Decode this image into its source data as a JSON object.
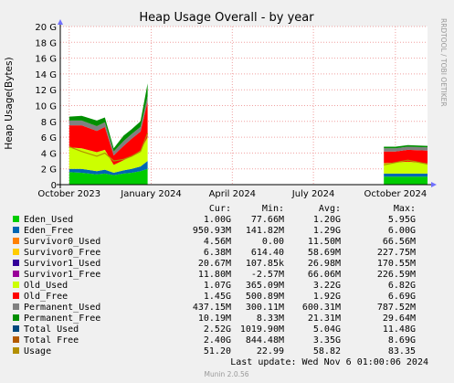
{
  "chart_data": {
    "type": "area",
    "title": "Heap Usage Overall - by year",
    "ylabel": "Heap Usage(Bytes)",
    "side_label": "RRDTOOL / TOBI OETIKER",
    "ylim": [
      0,
      20
    ],
    "yunit": "G",
    "y_ticks": [
      "0",
      "2 G",
      "4 G",
      "6 G",
      "8 G",
      "10 G",
      "12 G",
      "14 G",
      "16 G",
      "18 G",
      "20 G"
    ],
    "x_ticks": [
      "October 2023",
      "January 2024",
      "April 2024",
      "July 2024",
      "October 2024"
    ],
    "grid": true,
    "x_segments": [
      {
        "x": [
          "2023-10-01",
          "2023-10-15",
          "2023-11-01",
          "2023-11-10",
          "2023-11-20",
          "2023-12-01",
          "2023-12-10",
          "2023-12-20",
          "2023-12-28"
        ],
        "Eden_Used": [
          1.6,
          1.5,
          1.3,
          1.4,
          1.2,
          1.4,
          1.5,
          1.7,
          2.0
        ],
        "Eden_Free": [
          0.4,
          0.5,
          0.4,
          0.5,
          0.3,
          0.4,
          0.5,
          0.6,
          1.0
        ],
        "Old_Used": [
          2.7,
          2.6,
          2.4,
          2.5,
          1.0,
          1.3,
          1.6,
          2.0,
          3.0
        ],
        "Old_Free": [
          2.8,
          2.9,
          2.7,
          2.9,
          1.2,
          1.8,
          2.2,
          2.4,
          4.5
        ],
        "Permanent_Used": [
          0.6,
          0.6,
          0.6,
          0.6,
          0.5,
          0.6,
          0.6,
          0.6,
          0.7
        ],
        "Permanent_Free": [
          0.5,
          0.6,
          0.7,
          0.6,
          0.4,
          0.7,
          0.6,
          0.7,
          1.6
        ],
        "Usage": [
          4.8,
          4.2,
          3.6,
          4.0,
          3.0,
          3.2,
          3.6,
          4.2,
          6.5
        ]
      },
      {
        "x": [
          "2024-09-18",
          "2024-10-01",
          "2024-10-15",
          "2024-11-06"
        ],
        "Eden_Used": [
          1.0,
          1.0,
          1.0,
          1.0
        ],
        "Eden_Free": [
          0.4,
          0.4,
          0.4,
          0.4
        ],
        "Old_Used": [
          1.3,
          1.4,
          1.5,
          1.3
        ],
        "Old_Free": [
          1.5,
          1.4,
          1.5,
          1.6
        ],
        "Permanent_Used": [
          0.4,
          0.4,
          0.4,
          0.4
        ],
        "Permanent_Free": [
          0.2,
          0.2,
          0.2,
          0.2
        ],
        "Usage": [
          2.5,
          2.8,
          3.1,
          2.6
        ]
      }
    ],
    "table_headers": [
      "Cur:",
      "Min:",
      "Avg:",
      "Max:"
    ],
    "series": [
      {
        "name": "Eden_Used",
        "color": "#00cc00",
        "cur": "1.00G",
        "min": "77.66M",
        "avg": "1.20G",
        "max": "5.95G"
      },
      {
        "name": "Eden_Free",
        "color": "#0066b3",
        "cur": "950.93M",
        "min": "141.82M",
        "avg": "1.29G",
        "max": "6.00G"
      },
      {
        "name": "Survivor0_Used",
        "color": "#ff8000",
        "cur": "4.56M",
        "min": "0.00",
        "avg": "11.50M",
        "max": "66.56M"
      },
      {
        "name": "Survivor0_Free",
        "color": "#ffcc00",
        "cur": "6.38M",
        "min": "614.40",
        "avg": "58.69M",
        "max": "227.75M"
      },
      {
        "name": "Survivor1_Used",
        "color": "#330099",
        "cur": "20.67M",
        "min": "107.85k",
        "avg": "26.98M",
        "max": "170.55M"
      },
      {
        "name": "Survivor1_Free",
        "color": "#990099",
        "cur": "11.80M",
        "min": "-2.57M",
        "avg": "66.06M",
        "max": "226.59M"
      },
      {
        "name": "Old_Used",
        "color": "#ccff00",
        "cur": "1.07G",
        "min": "365.09M",
        "avg": "3.22G",
        "max": "6.82G"
      },
      {
        "name": "Old_Free",
        "color": "#ff0000",
        "cur": "1.45G",
        "min": "500.89M",
        "avg": "1.92G",
        "max": "6.69G"
      },
      {
        "name": "Permanent_Used",
        "color": "#808080",
        "cur": "437.15M",
        "min": "300.11M",
        "avg": "600.31M",
        "max": "787.52M"
      },
      {
        "name": "Permanent_Free",
        "color": "#008f00",
        "cur": "10.19M",
        "min": "8.33M",
        "avg": "21.31M",
        "max": "29.64M"
      },
      {
        "name": "Total Used",
        "color": "#00487d",
        "cur": "2.52G",
        "min": "1019.90M",
        "avg": "5.04G",
        "max": "11.48G"
      },
      {
        "name": "Total Free",
        "color": "#b35a00",
        "cur": "2.40G",
        "min": "844.48M",
        "avg": "3.35G",
        "max": "8.69G"
      },
      {
        "name": "Usage",
        "color": "#b38f00",
        "cur": "51.20",
        "min": "22.99",
        "avg": "58.82",
        "max": "83.35"
      }
    ],
    "last_update": "Last update: Wed Nov  6 01:00:06 2024",
    "footer": "Munin 2.0.56"
  }
}
